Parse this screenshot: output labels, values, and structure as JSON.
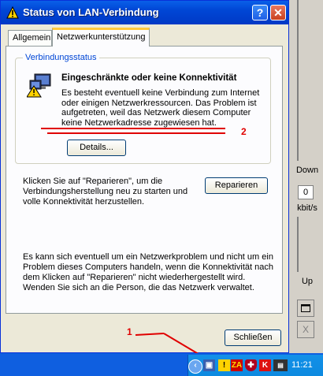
{
  "window": {
    "title": "Status von LAN-Verbindung",
    "help_glyph": "?",
    "close_glyph": "✕"
  },
  "tabs": [
    {
      "label": "Allgemein"
    },
    {
      "label": "Netzwerkunterstützung"
    }
  ],
  "status_group": {
    "label": "Verbindungsstatus",
    "heading": "Eingeschränkte oder keine Konnektivität",
    "lines": [
      "Es besteht eventuell keine Verbindung zum Internet",
      "oder einigen Netzwerkressourcen. Das Problem ist",
      "aufgetreten, weil das Netzwerk diesem Computer",
      "keine Netzwerkadresse zugewiesen hat."
    ],
    "details_button": "Details..."
  },
  "repair": {
    "lines": [
      "Klicken Sie auf \"Reparieren\", um die",
      "Verbindungsherstellung neu zu starten und",
      "volle Konnektivität herzustellen."
    ],
    "button": "Reparieren"
  },
  "info": {
    "lines": [
      "Es kann sich eventuell um ein Netzwerkproblem und nicht um ein",
      "Problem dieses Computers handeln, wenn die Konnektivität nach",
      "dem Klicken auf \"Reparieren\" nicht wiederhergestellt wird.",
      "Wenden Sie sich an die Person, die das Netzwerk verwaltet."
    ]
  },
  "close_button": "Schließen",
  "annotations": {
    "marker_1": "1",
    "marker_2": "2"
  },
  "bandwidth": {
    "down_label": "Down",
    "down_value": "0",
    "unit": "kbit/s",
    "up_label": "Up",
    "x_glyph": "X"
  },
  "taskbar": {
    "clock": "11:21",
    "tray_icons": [
      "chevron-left-icon",
      "network-warning-icon",
      "zonealarm-icon",
      "security-shield-icon",
      "antivirus-icon",
      "extra-tray-icon"
    ]
  },
  "colors": {
    "annotation_red": "#e00000",
    "title_blue": "#0046d5",
    "taskbar_blue": "#0f5fe0"
  }
}
